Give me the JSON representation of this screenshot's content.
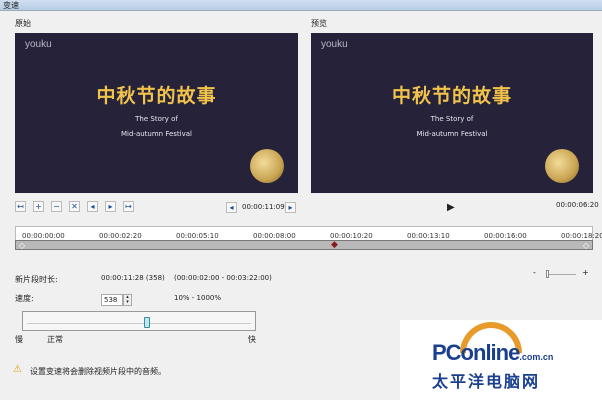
{
  "window": {
    "title": "变速"
  },
  "original": {
    "label": "原始",
    "logo": "youku",
    "title_cn": "中秋节的故事",
    "title_en1": "The Story of",
    "title_en2": "Mid-autumn Festival"
  },
  "preview": {
    "label": "预览",
    "logo": "youku",
    "title_cn": "中秋节的故事",
    "title_en1": "The Story of",
    "title_en2": "Mid-autumn Festival",
    "time": "00:00:06:20"
  },
  "toolbar": {
    "icons": [
      "mark-in-icon",
      "add-icon",
      "remove-icon",
      "split-icon",
      "prev-frame-icon",
      "next-frame-icon",
      "mark-out-icon"
    ],
    "current_time": "00:00:11:09"
  },
  "timeline": {
    "ticks": [
      "00:00:00:00",
      "00:00:02:20",
      "00:00:05:10",
      "00:00:08:00",
      "00:00:10:20",
      "00:00:13:10",
      "00:00:16:00",
      "00:00:18:20"
    ],
    "playhead_color": "#8b1a1a"
  },
  "info": {
    "duration_label": "新片段时长:",
    "duration_value": "00:00:11:28 (358)",
    "duration_range": "(00:00:02:00 - 00:03:22:00)",
    "speed_label": "速度:",
    "speed_value": "538",
    "speed_range": "10% - 1000%"
  },
  "speed_slider": {
    "slow": "慢",
    "normal": "正常",
    "fast": "快",
    "value_percent": 538
  },
  "zoom": {
    "minus": "-",
    "plus": "+"
  },
  "warning": {
    "text": "设置变速将会删除视频片段中的音频。"
  },
  "watermark": {
    "brand": "PConline",
    "domain": ".com.cn",
    "cn": "太平洋电脑网"
  }
}
